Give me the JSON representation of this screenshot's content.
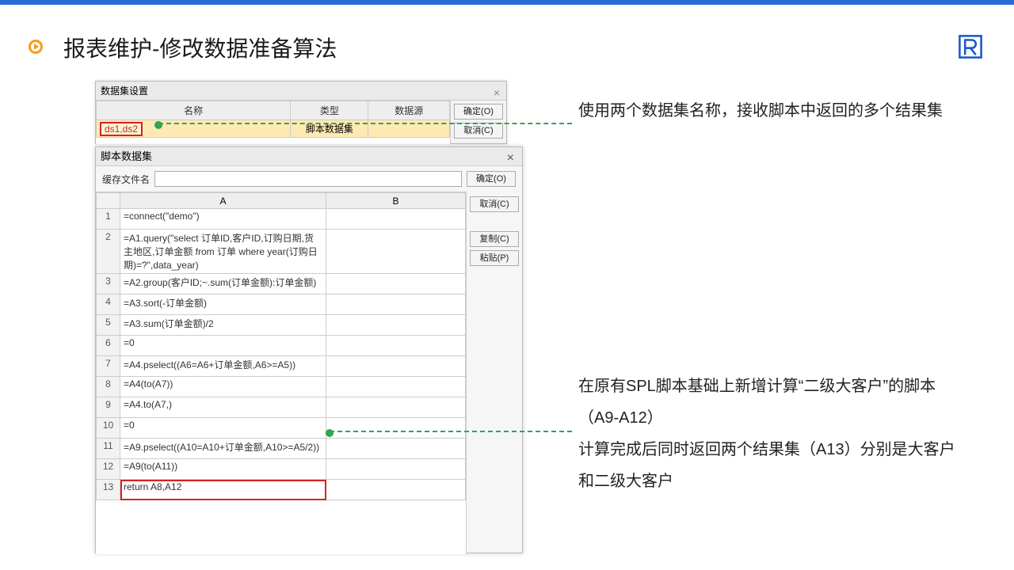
{
  "slide": {
    "title": "报表维护-修改数据准备算法"
  },
  "dialog1": {
    "title": "数据集设置",
    "headers": {
      "name": "名称",
      "type": "类型",
      "ds": "数据源"
    },
    "row": {
      "name": "ds1,ds2",
      "type": "脚本数据集",
      "ds": ""
    },
    "buttons": {
      "ok": "确定(O)",
      "cancel": "取消(C)"
    }
  },
  "dialog2": {
    "title": "脚本数据集",
    "cacheLabel": "缓存文件名",
    "cacheValue": "",
    "headers": {
      "a": "A",
      "b": "B"
    },
    "buttons": {
      "ok": "确定(O)",
      "cancel": "取消(C)",
      "copy": "复制(C)",
      "paste": "粘贴(P)"
    },
    "rows": [
      {
        "n": "1",
        "a": "=connect(\"demo\")",
        "b": ""
      },
      {
        "n": "2",
        "a": "=A1.query(\"select 订单ID,客户ID,订购日期,货主地区,订单金额 from 订单 where year(订购日期)=?\",data_year)",
        "b": ""
      },
      {
        "n": "3",
        "a": "=A2.group(客户ID;~.sum(订单金额):订单金额)",
        "b": ""
      },
      {
        "n": "4",
        "a": "=A3.sort(-订单金额)",
        "b": ""
      },
      {
        "n": "5",
        "a": "=A3.sum(订单金额)/2",
        "b": ""
      },
      {
        "n": "6",
        "a": "=0",
        "b": ""
      },
      {
        "n": "7",
        "a": "=A4.pselect((A6=A6+订单金额,A6>=A5))",
        "b": ""
      },
      {
        "n": "8",
        "a": "=A4(to(A7))",
        "b": ""
      },
      {
        "n": "9",
        "a": "=A4.to(A7,)",
        "b": ""
      },
      {
        "n": "10",
        "a": "=0",
        "b": ""
      },
      {
        "n": "11",
        "a": "=A9.pselect((A10=A10+订单金额,A10>=A5/2))",
        "b": ""
      },
      {
        "n": "12",
        "a": "=A9(to(A11))",
        "b": ""
      },
      {
        "n": "13",
        "a": "return A8,A12",
        "b": ""
      }
    ]
  },
  "explain": {
    "p1": "使用两个数据集名称，接收脚本中返回的多个结果集",
    "p2a": "在原有SPL脚本基础上新增计算“二级大客户”的脚本（A9-A12）",
    "p2b": "计算完成后同时返回两个结果集（A13）分别是大客户和二级大客户"
  }
}
